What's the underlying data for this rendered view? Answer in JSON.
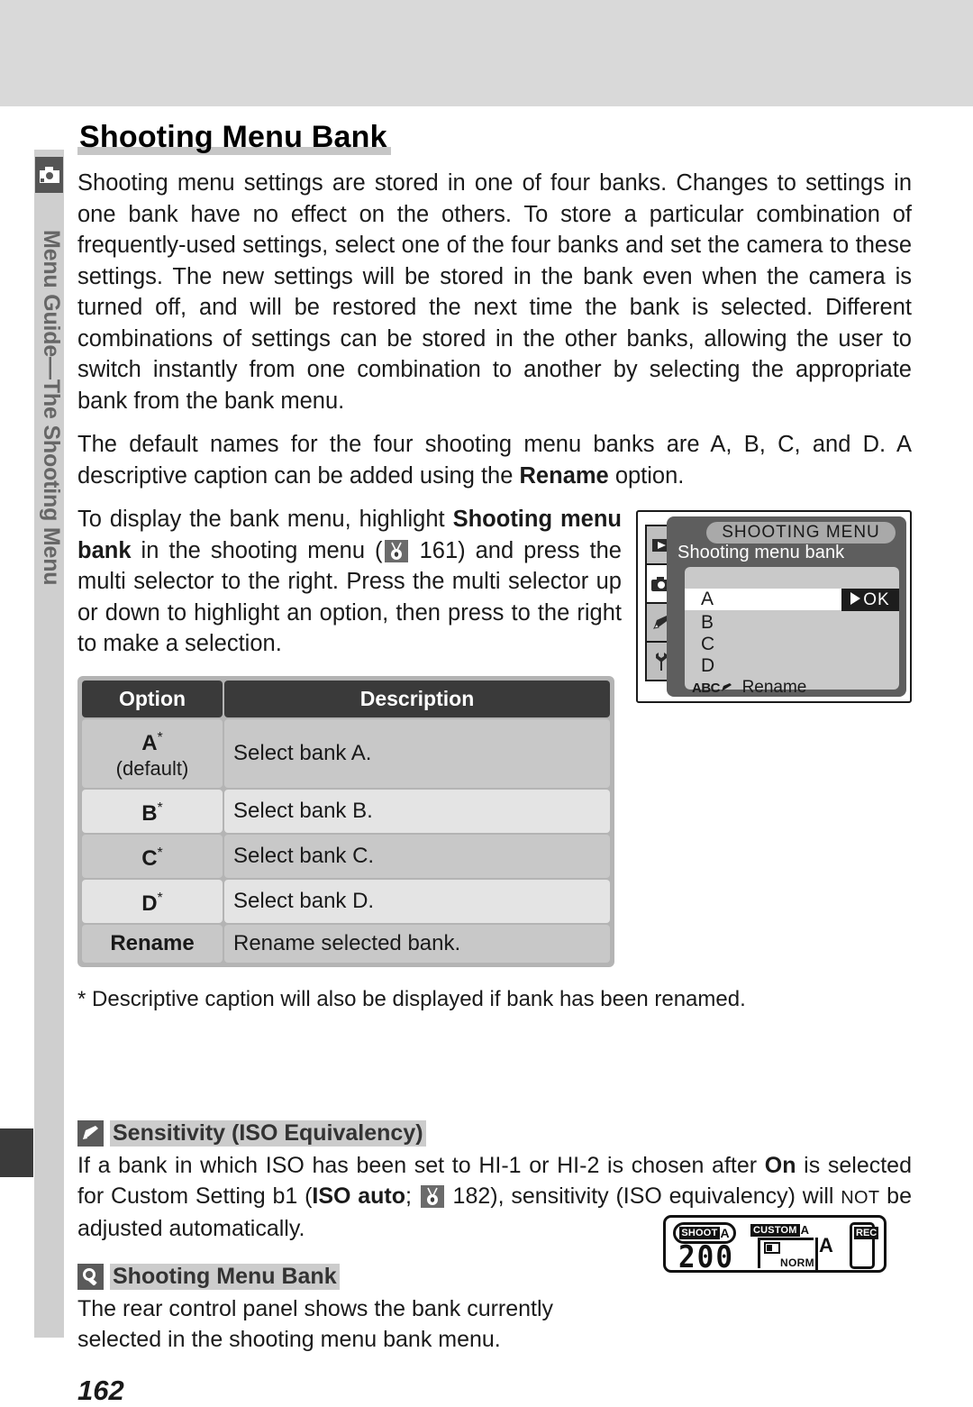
{
  "sidebar": {
    "icon": "camera-icon",
    "label": "Menu Guide—The Shooting Menu"
  },
  "page": {
    "title": "Shooting Menu Bank",
    "number": "162"
  },
  "body": {
    "p1": "Shooting menu settings are stored in one of four banks.  Changes to settings in one bank have no effect on the others.  To store a particular combination of frequently-used settings, select one of the four banks and set the camera to these settings.  The new settings will be stored in the bank even when the camera is turned off, and will be restored the next time the bank is selected.  Different combinations of settings can be stored in the other banks, allowing the user to switch instantly from one combination to another by selecting the appropriate bank from the bank menu.",
    "p2_a": "The default names for the four shooting menu banks are A, B, C, and D.  A descriptive caption can be added using the ",
    "p2_bold": "Rename",
    "p2_b": " option.",
    "p3_a": "To display the bank menu, highlight ",
    "p3_bold1": "Shooting menu bank",
    "p3_b": " in the shooting menu (",
    "p3_ref": "161",
    "p3_c": ") and press the multi selector to the right.  Press the multi selector up or down to highlight an option, then press to the right to make a selection."
  },
  "lcd": {
    "title": "SHOOTING MENU",
    "subtitle": "Shooting menu bank",
    "ok_label": "OK",
    "rows": [
      {
        "label": "A",
        "selected": true
      },
      {
        "label": "B",
        "selected": false
      },
      {
        "label": "C",
        "selected": false
      },
      {
        "label": "D",
        "selected": false
      }
    ],
    "rename_mark": "ABC",
    "rename_label": "Rename",
    "tabs": [
      {
        "name": "playback-tab",
        "icon": "play-icon"
      },
      {
        "name": "shooting-menu-tab",
        "icon": "camera-icon"
      },
      {
        "name": "custom-settings-tab",
        "icon": "pencil-icon"
      },
      {
        "name": "setup-tab",
        "icon": "wrench-icon"
      }
    ]
  },
  "table": {
    "headers": {
      "option": "Option",
      "description": "Description"
    },
    "rows": [
      {
        "option": "A",
        "star": "*",
        "note": "(default)",
        "description": "Select bank A."
      },
      {
        "option": "B",
        "star": "*",
        "note": "",
        "description": "Select bank B."
      },
      {
        "option": "C",
        "star": "*",
        "note": "",
        "description": "Select bank C."
      },
      {
        "option": "D",
        "star": "*",
        "note": "",
        "description": "Select bank D."
      },
      {
        "option": "Rename",
        "star": "",
        "note": "",
        "description": "Rename selected bank."
      }
    ],
    "footnote": "* Descriptive caption will also be displayed if bank has been renamed."
  },
  "notes": [
    {
      "icon": "pencil-icon",
      "title": "Sensitivity (ISO Equivalency)",
      "t1": "If a bank in which ISO has been set to HI-1 or HI-2 is chosen after ",
      "b1": "On",
      "t2": " is selected for Custom Setting b1 (",
      "b2": "ISO auto",
      "t3": "; ",
      "ref": "182",
      "t4": "), sensitivity (ISO equivalency) will ",
      "smallcaps": "NOT",
      "t5": " be adjusted automatically."
    },
    {
      "icon": "magnifier-icon",
      "title": "Shooting Menu Bank",
      "t1": "The rear control panel shows the bank currently selected in the shooting menu bank menu."
    }
  ],
  "control_panel": {
    "shoot_tag": "SHOOT",
    "shoot_bank": "A",
    "iso_value": "200",
    "custom_tag": "CUSTOM",
    "custom_bank": "A",
    "quality": "NORM",
    "bank_letter": "A",
    "rec_tag": "REC"
  },
  "colors": {
    "band": "#d9d9d9",
    "sidebar": "#cfcfcf",
    "table_header": "#3a3a3a",
    "row_shade": "#c8c8c8",
    "row_light": "#e4e4e4",
    "lcd_body": "#5e5e5e"
  }
}
